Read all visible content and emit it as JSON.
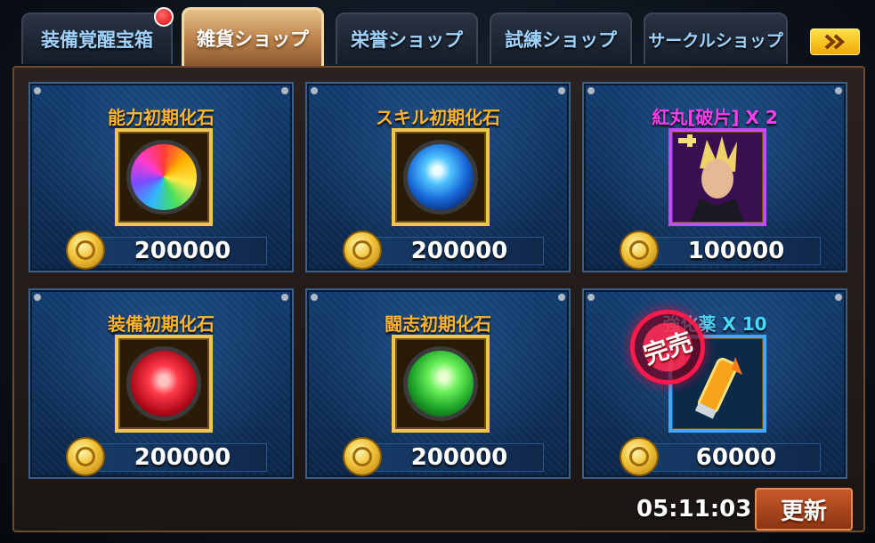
{
  "tabs": [
    {
      "label": "装備覚醒宝箱",
      "active": false,
      "notification": true
    },
    {
      "label": "雑貨ショップ",
      "active": true,
      "notification": false
    },
    {
      "label": "栄誉ショップ",
      "active": false,
      "notification": false
    },
    {
      "label": "試練ショップ",
      "active": false,
      "notification": false
    },
    {
      "label": "サークルショップ",
      "active": false,
      "notification": false
    }
  ],
  "next_tabs_icon": "double-chevron-right-icon",
  "items": [
    {
      "name": "能力初期化石",
      "price": "200000",
      "icon": "rainbow-gem-icon",
      "rarity_color": "#f1c44c",
      "sold_out": false
    },
    {
      "name": "スキル初期化石",
      "price": "200000",
      "icon": "blue-swirl-gem-icon",
      "rarity_color": "#f1c44c",
      "sold_out": false
    },
    {
      "name": "紅丸[破片] X 2",
      "price": "100000",
      "icon": "benimaru-fragment-portrait",
      "rarity_color": "#c54bff",
      "sold_out": false
    },
    {
      "name": "装備初期化石",
      "price": "200000",
      "icon": "red-gem-icon",
      "rarity_color": "#f1c44c",
      "sold_out": false
    },
    {
      "name": "闘志初期化石",
      "price": "200000",
      "icon": "green-flame-gem-icon",
      "rarity_color": "#f1c44c",
      "sold_out": false
    },
    {
      "name": "強化薬 X 10",
      "price": "60000",
      "icon": "enhancement-potion-icon",
      "rarity_color": "#3fa8ff",
      "sold_out": true,
      "sold_out_label": "完売"
    }
  ],
  "timer": "05:11:03",
  "refresh_label": "更新",
  "currency_icon": "gold-coin-icon"
}
